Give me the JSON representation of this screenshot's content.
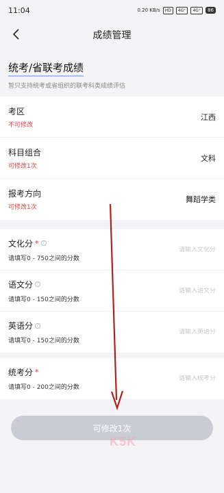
{
  "status_bar": {
    "time": "11:04",
    "net_speed": "0.20 KB/s",
    "hd": "HD",
    "sig1": "4G⁺",
    "sig2": "4G⁺",
    "battery": "86"
  },
  "nav": {
    "title": "成绩管理"
  },
  "heading": {
    "title": "统考/省联考成绩",
    "subtitle": "暂只支持统考或省组织的联考科类成绩评估"
  },
  "info_rows": [
    {
      "label": "考区",
      "note": "不可修改",
      "value": "江西"
    },
    {
      "label": "科目组合",
      "note": "可修改1次",
      "value": "文科"
    },
    {
      "label": "报考方向",
      "note": "可修改1次",
      "value": "舞蹈学类"
    }
  ],
  "score_rows": [
    {
      "label": "文化分",
      "required": "*",
      "hint": "请填写0 - 750之间的分数",
      "placeholder": "请输入文化分"
    },
    {
      "label": "语文分",
      "hint": "请填写0 - 150之间的分数",
      "placeholder": "请输入语文分"
    },
    {
      "label": "英语分",
      "hint": "请填写0 - 150之间的分数",
      "placeholder": "请输入英语分"
    }
  ],
  "unified_score": {
    "label": "统考分",
    "required": "*",
    "hint": "请填写0 - 200之间的分数",
    "placeholder": "请输入统考分"
  },
  "submit": {
    "label": "可修改1次"
  },
  "watermark": {
    "text": "K5K"
  },
  "colors": {
    "accent_underline": "#9ec2ff",
    "note_red": "#cc4444",
    "button_gray": "#c9ccd3",
    "arrow": "#b02020"
  }
}
